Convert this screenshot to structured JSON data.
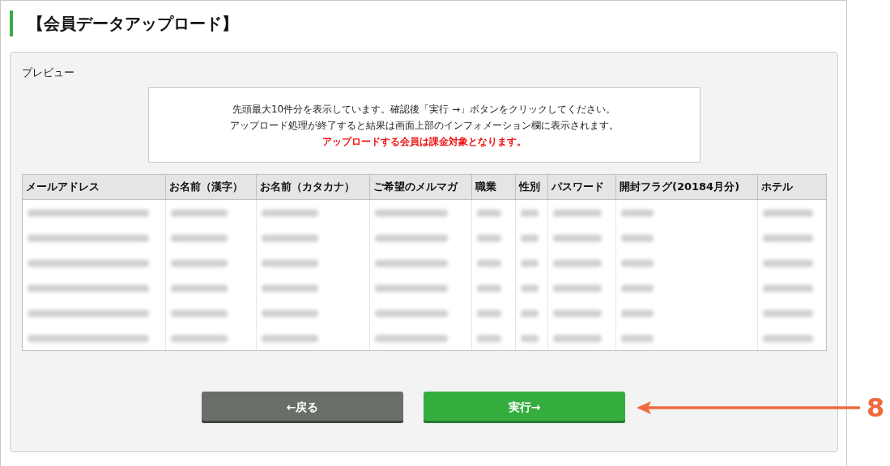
{
  "page_title": "【会員データアップロード】",
  "preview": {
    "label": "プレビュー",
    "notice": {
      "lines": [
        "先頭最大10件分を表示しています。確認後「実行 →」ボタンをクリックしてください。",
        "アップロード処理が終了すると結果は画面上部のインフォメーション欄に表示されます。"
      ],
      "warning": "アップロードする会員は課金対象となります。"
    },
    "table": {
      "columns": [
        "メールアドレス",
        "お名前（漢字）",
        "お名前（カタカナ）",
        "ご希望のメルマガ",
        "職業",
        "性別",
        "パスワード",
        "開封フラグ(20184月分)",
        "ホテル"
      ],
      "rows": [
        {
          "cells": [
            {
              "kind": "redacted"
            },
            {
              "kind": "redacted"
            },
            {
              "kind": "redacted"
            },
            {
              "kind": "redacted"
            },
            {
              "kind": "redacted"
            },
            {
              "kind": "redacted"
            },
            {
              "kind": "redacted"
            },
            {
              "kind": "redacted"
            },
            {
              "kind": "redacted"
            }
          ]
        },
        {
          "cells": [
            {
              "kind": "redacted"
            },
            {
              "kind": "redacted"
            },
            {
              "kind": "redacted"
            },
            {
              "kind": "redacted"
            },
            {
              "kind": "redacted"
            },
            {
              "kind": "redacted"
            },
            {
              "kind": "redacted"
            },
            {
              "kind": "redacted"
            },
            {
              "kind": "redacted"
            }
          ]
        },
        {
          "cells": [
            {
              "kind": "redacted"
            },
            {
              "kind": "redacted"
            },
            {
              "kind": "redacted"
            },
            {
              "kind": "redacted"
            },
            {
              "kind": "redacted"
            },
            {
              "kind": "redacted"
            },
            {
              "kind": "redacted"
            },
            {
              "kind": "redacted"
            },
            {
              "kind": "redacted"
            }
          ]
        },
        {
          "cells": [
            {
              "kind": "redacted"
            },
            {
              "kind": "redacted"
            },
            {
              "kind": "redacted"
            },
            {
              "kind": "redacted"
            },
            {
              "kind": "redacted"
            },
            {
              "kind": "redacted"
            },
            {
              "kind": "redacted"
            },
            {
              "kind": "redacted"
            },
            {
              "kind": "redacted"
            }
          ]
        },
        {
          "cells": [
            {
              "kind": "redacted"
            },
            {
              "kind": "redacted"
            },
            {
              "kind": "redacted"
            },
            {
              "kind": "redacted"
            },
            {
              "kind": "redacted"
            },
            {
              "kind": "redacted"
            },
            {
              "kind": "redacted"
            },
            {
              "kind": "redacted"
            },
            {
              "kind": "redacted"
            }
          ]
        },
        {
          "cells": [
            {
              "kind": "redacted"
            },
            {
              "kind": "redacted"
            },
            {
              "kind": "redacted"
            },
            {
              "kind": "redacted"
            },
            {
              "kind": "redacted"
            },
            {
              "kind": "redacted"
            },
            {
              "kind": "redacted"
            },
            {
              "kind": "redacted"
            },
            {
              "kind": "redacted"
            }
          ]
        }
      ]
    },
    "buttons": [
      {
        "kind": "back",
        "label": "←戻る"
      },
      {
        "kind": "execute",
        "label": "実行→"
      }
    ]
  },
  "annotation": {
    "label": "8"
  }
}
